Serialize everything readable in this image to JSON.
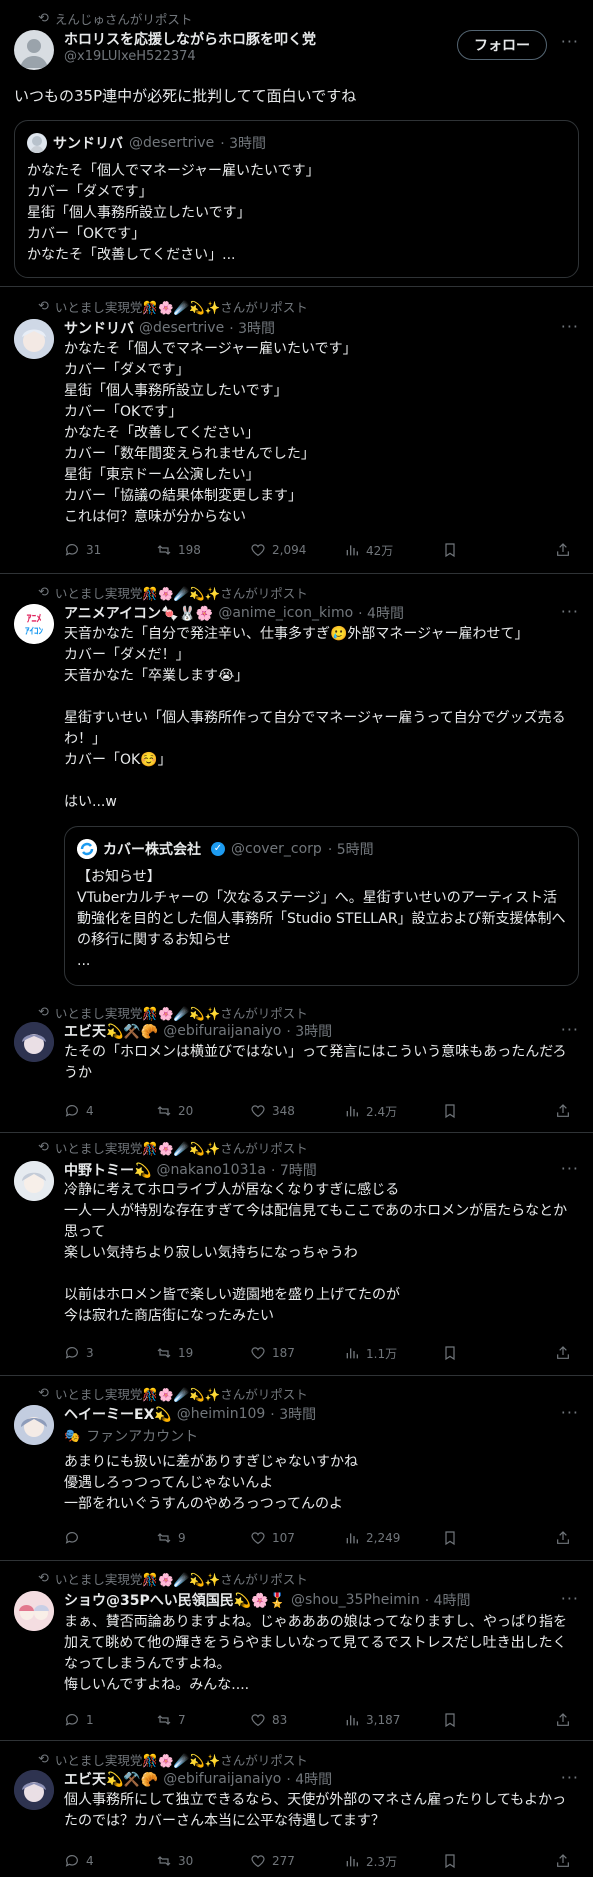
{
  "colors": {
    "bg": "#000000",
    "text": "#e7e9ea",
    "muted": "#71767b",
    "border": "#2f3336",
    "accent": "#1d9bf0"
  },
  "t1": {
    "repost": "えんじゅさんがリポスト",
    "name": "ホロリスを応援しながらホロ豚を叩く党",
    "handle": "@x19LUlxeH522374",
    "follow": "フォロー",
    "text": "いつもの35P連中が必死に批判してて面白いですね",
    "quote": {
      "name": "サンドリバ",
      "handle": "@desertrive",
      "time": "· 3時間",
      "text": "かなたそ「個人でマネージャー雇いたいです」\nカバー「ダメです」\n星街「個人事務所設立したいです」\nカバー「OKです」\nかなたそ「改善してください」..."
    }
  },
  "t2": {
    "repost": "いとまし実現党🎊🌸☄️💫✨さんがリポスト",
    "name": "サンドリバ",
    "handle": "@desertrive",
    "time": "· 3時間",
    "text": "かなたそ「個人でマネージャー雇いたいです」\nカバー「ダメです」\n星街「個人事務所設立したいです」\nカバー「OKです」\nかなたそ「改善してください」\nカバー「数年間変えられませんでした」\n星街「東京ドーム公演したい」\nカバー「協議の結果体制変更します」\nこれは何？意味が分からない",
    "replies": "31",
    "reposts": "198",
    "likes": "2,094",
    "views": "42万"
  },
  "t3": {
    "repost": "いとまし実現党🎊🌸☄️💫✨さんがリポスト",
    "name": "アニメアイコン🍬🐰🌸",
    "handle": "@anime_icon_kimo",
    "time": "· 4時間",
    "text": "天音かなた「自分で発注辛い、仕事多すぎ🥲外部マネージャー雇わせて」\nカバー「ダメだ！」\n天音かなた「卒業します😭」\n\n星街すいせい「個人事務所作って自分でマネージャー雇うって自分でグッズ売るわ！」\nカバー「OK☺️」\n\nはい...w",
    "quote": {
      "name": "カバー株式会社",
      "handle": "@cover_corp",
      "time": "· 5時間",
      "text": "【お知らせ】\nVTuberカルチャーの「次なるステージ」へ。星街すいせいのアーティスト活動強化を目的とした個人事務所「Studio STELLAR」設立および新支援体制への移行に関するお知らせ\n..."
    }
  },
  "t4": {
    "repost": "いとまし実現党🎊🌸☄️💫✨さんがリポスト",
    "name": "エビ天💫⚒️🥐",
    "handle": "@ebifuraijanaiyo",
    "time": "· 3時間",
    "text": "たその「ホロメンは横並びではない」って発言にはこういう意味もあったんだろうか",
    "replies": "4",
    "reposts": "20",
    "likes": "348",
    "views": "2.4万"
  },
  "t5": {
    "repost": "いとまし実現党🎊🌸☄️💫✨さんがリポスト",
    "name": "中野トミー💫",
    "handle": "@nakano1031a",
    "time": "· 7時間",
    "text": "冷静に考えてホロライブ人が居なくなりすぎに感じる\n一人一人が特別な存在すぎて今は配信見てもここであのホロメンが居たらなとか思って\n楽しい気持ちより寂しい気持ちになっちゃうわ\n\n以前はホロメン皆で楽しい遊園地を盛り上げてたのが\n今は寂れた商店街になったみたい",
    "replies": "3",
    "reposts": "19",
    "likes": "187",
    "views": "1.1万"
  },
  "t6": {
    "repost": "いとまし実現党🎊🌸☄️💫✨さんがリポスト",
    "name": "ヘイーミーEX💫",
    "handle": "@heimin109",
    "time": "· 3時間",
    "fan": "ファンアカウント",
    "text": "あまりにも扱いに差がありすぎじゃないすかね\n優遇しろっつってんじゃないんよ\n一部をれいぐうすんのやめろっつってんのよ",
    "replies": "",
    "reposts": "9",
    "likes": "107",
    "views": "2,249"
  },
  "t7": {
    "repost": "いとまし実現党🎊🌸☄️💫✨さんがリポスト",
    "name": "ショウ@35Pへい民領国民💫🌸🎖️",
    "handle": "@shou_35Pheimin",
    "time": "· 4時間",
    "text": "まぁ、賛否両論ありますよね。じゃあああの娘はってなりますし、やっぱり指を加えて眺めて他の輝きをうらやましいなって見てるでストレスだし吐き出したくなってしまうんですよね。\n悔しいんですよね。みんな....",
    "replies": "1",
    "reposts": "7",
    "likes": "83",
    "views": "3,187"
  },
  "t8": {
    "repost": "いとまし実現党🎊🌸☄️💫✨さんがリポスト",
    "name": "エビ天💫⚒️🥐",
    "handle": "@ebifuraijanaiyo",
    "time": "· 4時間",
    "text": "個人事務所にして独立できるなら、天使が外部のマネさん雇ったりしてもよかったのでは？カバーさん本当に公平な待遇してます？",
    "replies": "4",
    "reposts": "30",
    "likes": "277",
    "views": "2.3万"
  }
}
